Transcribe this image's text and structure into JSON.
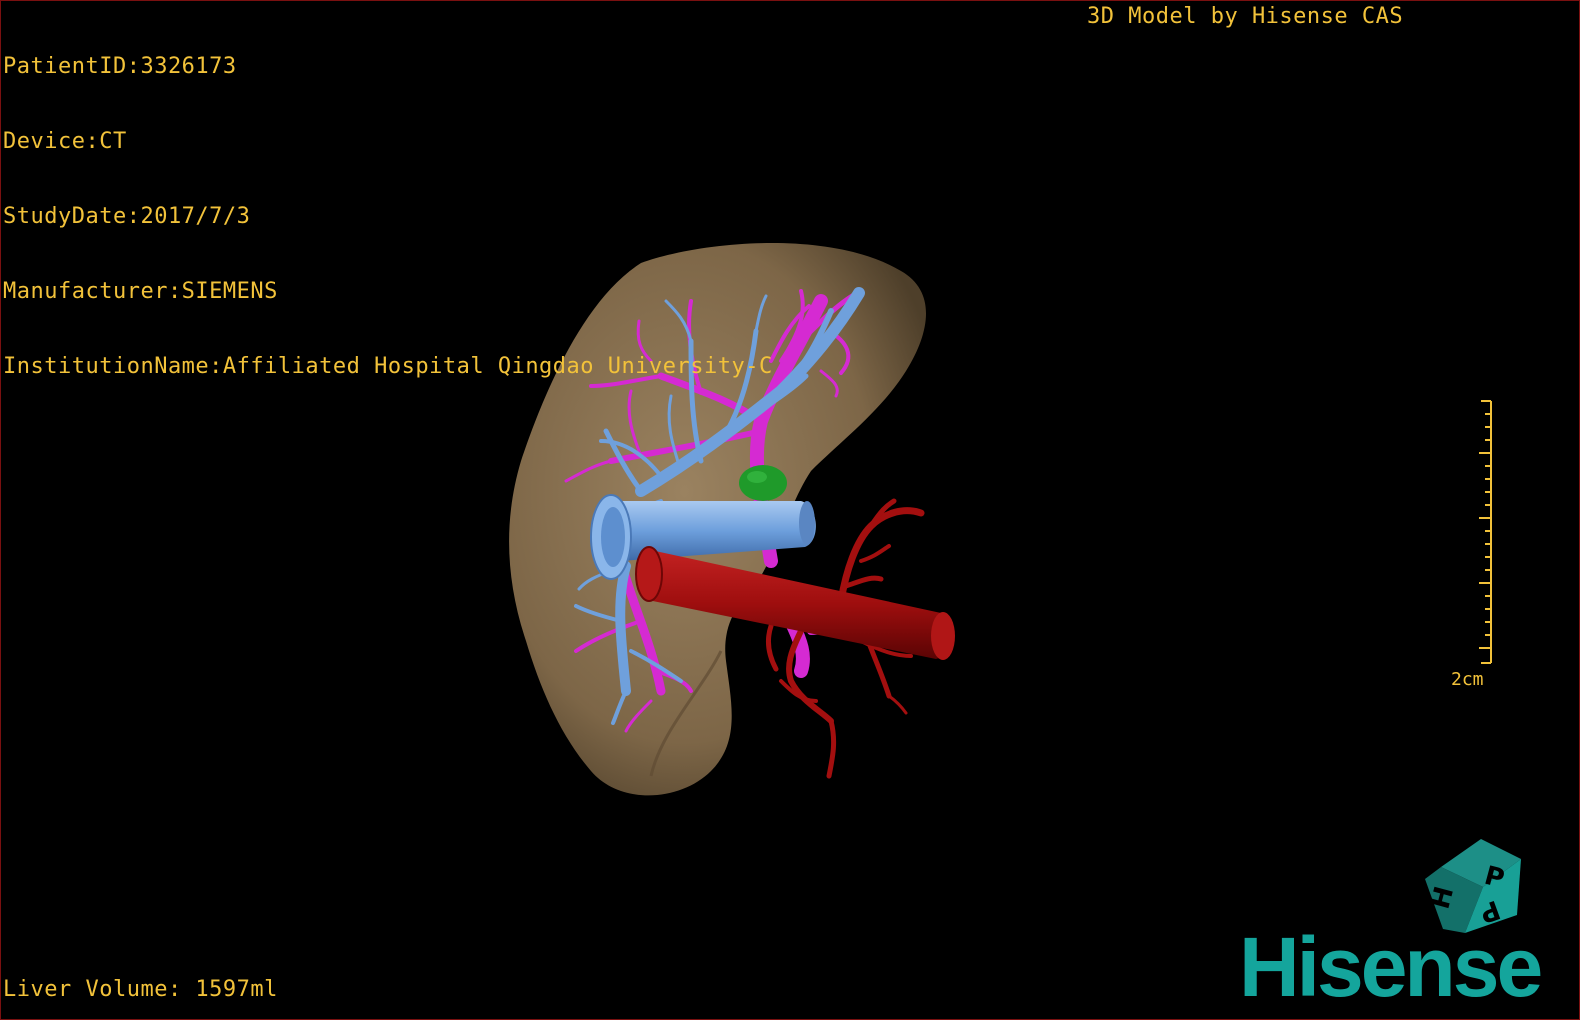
{
  "viewer": {
    "patient_id": "PatientID:3326173",
    "device": "Device:CT",
    "study_date": "StudyDate:2017/7/3",
    "manufacturer": "Manufacturer:SIEMENS",
    "institution": "InstitutionName:Affiliated Hospital Qingdao University-C",
    "brand_title": "3D Model by Hisense CAS",
    "liver_volume": "Liver Volume: 1597ml"
  },
  "scale_bar": {
    "label": "2cm"
  },
  "orientation_cube": {
    "face_top": "P",
    "face_left": "H",
    "face_right": "P",
    "icon": "orientation-cube-icon"
  },
  "logo": {
    "text": "Hisense"
  },
  "colors": {
    "overlay_text": "#f2c23a",
    "liver": "#8c7455",
    "portal_vein": "#6fa0dc",
    "hepatic_vein": "#d52ad2",
    "artery": "#a30f0f",
    "lesion": "#1f9a2a",
    "logo": "#14a59c"
  }
}
